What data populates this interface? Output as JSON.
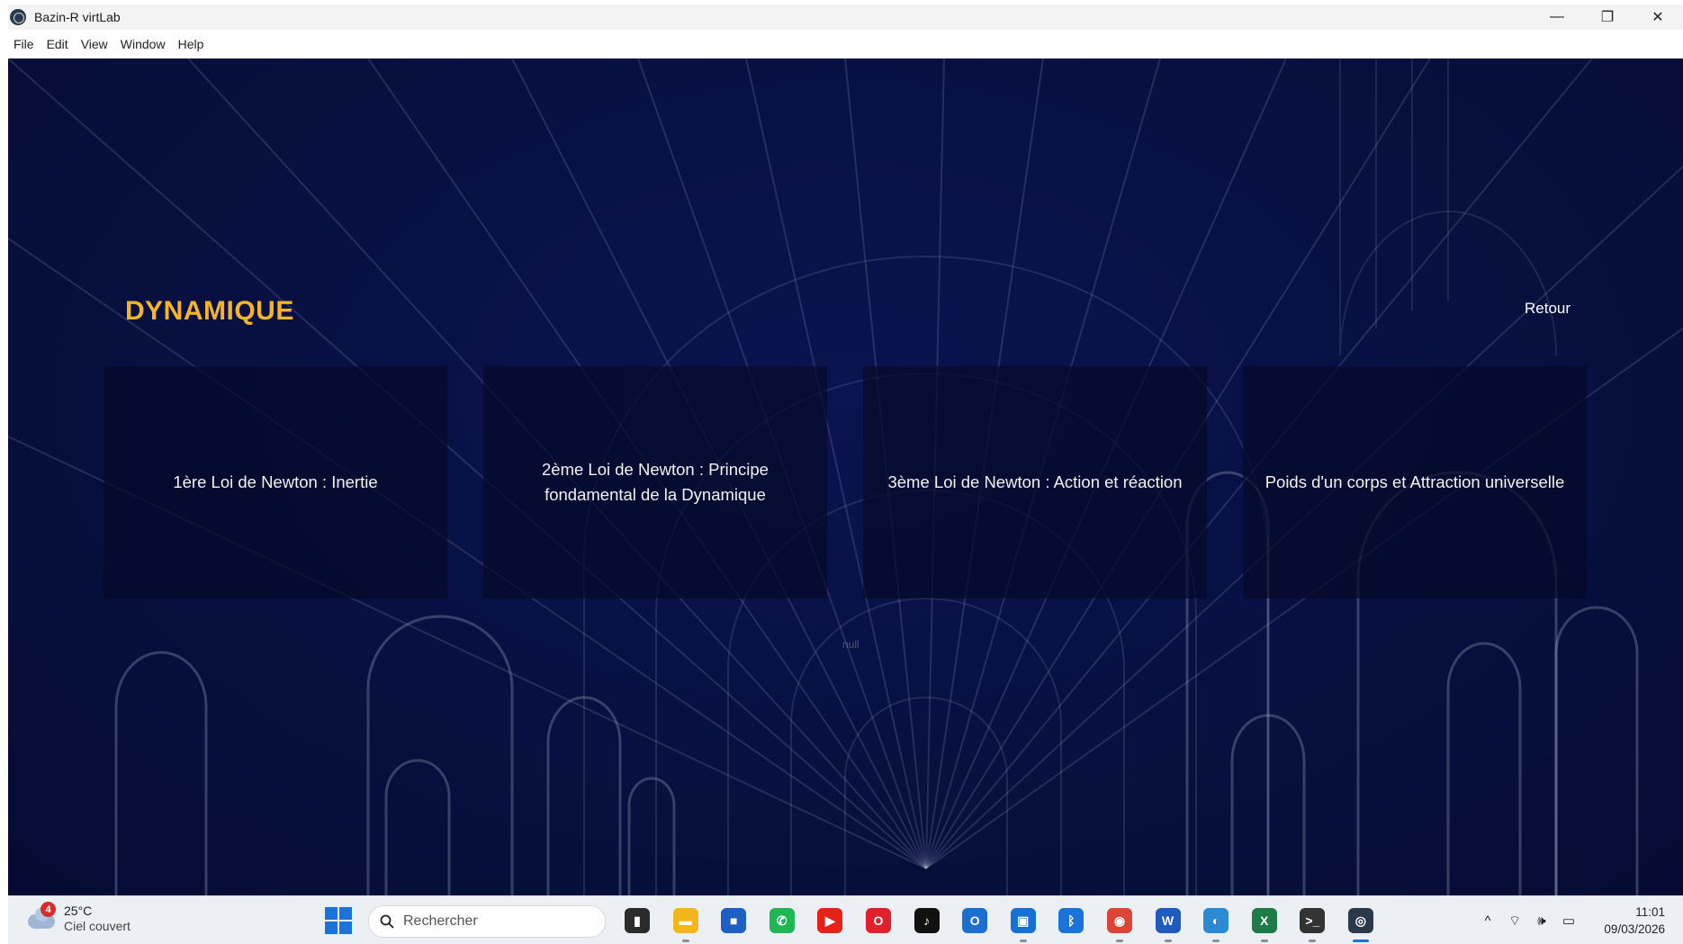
{
  "window": {
    "title": "Bazin-R virtLab",
    "minimize": "—",
    "maximize": "❐",
    "close": "✕"
  },
  "menu": [
    "File",
    "Edit",
    "View",
    "Window",
    "Help"
  ],
  "page": {
    "heading": "DYNAMIQUE",
    "back_label": "Retour",
    "cards": [
      "1ère Loi de Newton : Inertie",
      "2ème Loi de Newton : Principe fondamental de la Dynamique",
      "3ème Loi de Newton : Action et réaction",
      "Poids d'un corps et Attraction universelle"
    ],
    "null_text": "null",
    "colors": {
      "heading": "#f3b425",
      "background": "#071040"
    }
  },
  "taskbar": {
    "weather": {
      "badge": "4",
      "temp": "25°C",
      "desc": "Ciel couvert"
    },
    "search_placeholder": "Rechercher",
    "apps": [
      {
        "name": "task-view-icon",
        "color": "#2b2b2b",
        "glyph": "▮"
      },
      {
        "name": "file-explorer-icon",
        "color": "#f2b51c",
        "glyph": "▬"
      },
      {
        "name": "microsoft-store-icon",
        "color": "#1e5fc4",
        "glyph": "■"
      },
      {
        "name": "whatsapp-icon",
        "color": "#1fb855",
        "glyph": "✆"
      },
      {
        "name": "youtube-icon",
        "color": "#e62117",
        "glyph": "▶"
      },
      {
        "name": "opera-icon",
        "color": "#e0202b",
        "glyph": "O"
      },
      {
        "name": "tiktok-icon",
        "color": "#111111",
        "glyph": "♪"
      },
      {
        "name": "outlook-icon",
        "color": "#1b6fd0",
        "glyph": "O"
      },
      {
        "name": "remote-desktop-icon",
        "color": "#1770d4",
        "glyph": "▣"
      },
      {
        "name": "bluetooth-icon",
        "color": "#1a73d9",
        "glyph": "ᛒ"
      },
      {
        "name": "chrome-icon",
        "color": "#db4437",
        "glyph": "◉"
      },
      {
        "name": "word-icon",
        "color": "#1f5bbf",
        "glyph": "W"
      },
      {
        "name": "app-blue-icon",
        "color": "#2a8ad4",
        "glyph": "◐"
      },
      {
        "name": "excel-icon",
        "color": "#1d7b45",
        "glyph": "X"
      },
      {
        "name": "terminal-icon",
        "color": "#333333",
        "glyph": ">_"
      },
      {
        "name": "virtlab-icon",
        "color": "#2a3a4a",
        "glyph": "◎"
      }
    ],
    "tray": {
      "chevron": "^",
      "wifi": "⌔",
      "volume": "🕪",
      "battery": "▭"
    },
    "clock": {
      "time": "11:01",
      "date": "09/03/2026"
    }
  }
}
